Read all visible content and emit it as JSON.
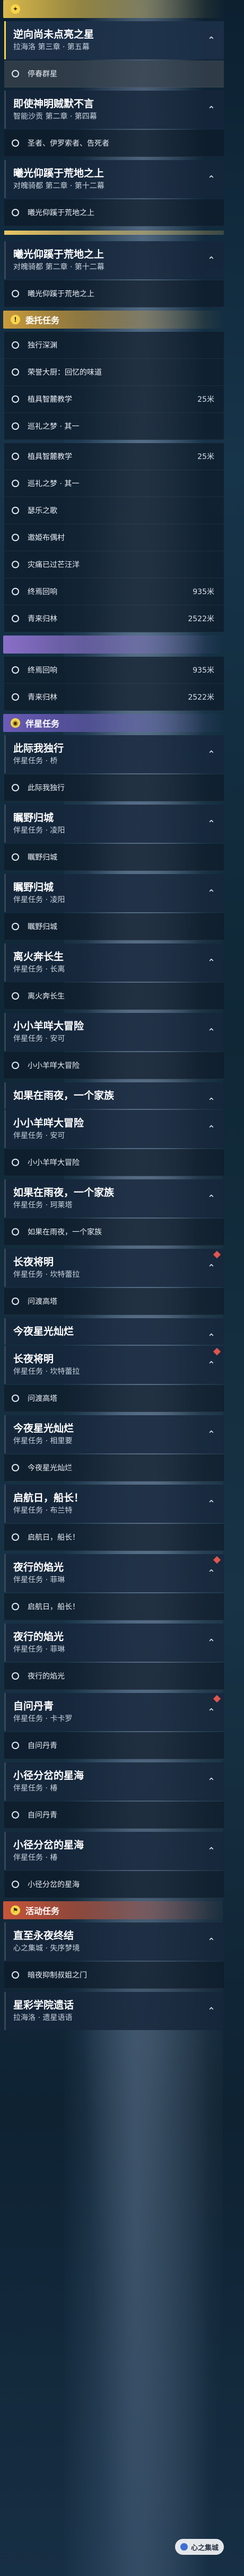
{
  "sections": [
    {
      "key": "main",
      "header": "",
      "color": "#d9b84a",
      "icon": "star-icon",
      "quests": [
        {
          "title": "逆向尚未点亮之星",
          "sub": "拉海洛 第三章 · 第五幕",
          "selected": true,
          "tasks": [
            {
              "label": "停春群星",
              "dist": "",
              "hl": true
            }
          ]
        },
        {
          "title": "即使神明贼默不言",
          "sub": "智能沙贡 第二章 · 第四幕",
          "selected": false,
          "tasks": [
            {
              "label": "圣者、伊罗索者、告死者",
              "dist": "",
              "hl": false
            }
          ]
        },
        {
          "title": "曦光仰蹊于荒地之上",
          "sub": "对魄骑都 第二章 · 第十二幕",
          "selected": false,
          "tasks": [
            {
              "label": "曦光仰蹊于荒地之上",
              "dist": "",
              "hl": false
            }
          ]
        }
      ],
      "after_gold": true
    },
    {
      "key": "main2",
      "header": "",
      "color": "",
      "icon": "",
      "quests": [
        {
          "title": "曦光仰蹊于荒地之上",
          "sub": "对魄骑都 第二章 · 第十二幕",
          "selected": false,
          "tasks": [
            {
              "label": "曦光仰蹊于荒地之上",
              "dist": "",
              "hl": false
            }
          ]
        }
      ],
      "after_gold": false
    },
    {
      "key": "daily",
      "header": "委托任务",
      "color": "#c99a3c",
      "icon": "exclaim-icon",
      "quests": [
        {
          "title": "",
          "sub": "",
          "selected": false,
          "tasks": [
            {
              "label": "独行深渊",
              "dist": "",
              "hl": false
            },
            {
              "label": "荣誉大厨：回忆的味道",
              "dist": "",
              "hl": false
            },
            {
              "label": "植具智麓教学",
              "dist": "25米",
              "hl": false
            },
            {
              "label": "巡礼之梦 · 其一",
              "dist": "",
              "hl": false
            }
          ]
        },
        {
          "title": "",
          "sub": "",
          "selected": false,
          "tasks": [
            {
              "label": "植具智麓教学",
              "dist": "25米",
              "hl": false
            },
            {
              "label": "巡礼之梦 · 其一",
              "dist": "",
              "hl": false
            },
            {
              "label": "瑟乐之歌",
              "dist": "",
              "hl": false
            },
            {
              "label": "邀姫布偶村",
              "dist": "",
              "hl": false
            },
            {
              "label": "灾痛已过芒汪洋",
              "dist": "",
              "hl": false
            },
            {
              "label": "终焉回响",
              "dist": "935米",
              "hl": false
            },
            {
              "label": "青来归林",
              "dist": "2522米",
              "hl": false
            }
          ]
        }
      ],
      "after_gold": false
    },
    {
      "key": "daily2",
      "header": "",
      "color": "#8a6fc8",
      "icon": "",
      "quests": [
        {
          "title": "",
          "sub": "",
          "selected": false,
          "tasks": [
            {
              "label": "终焉回响",
              "dist": "935米",
              "hl": false
            },
            {
              "label": "青来归林",
              "dist": "2522米",
              "hl": false
            }
          ]
        }
      ],
      "after_gold": false
    },
    {
      "key": "companion",
      "header": "伴星任务",
      "color": "#6b5bb8",
      "icon": "planet-icon",
      "quests": [
        {
          "title": "此际我独行",
          "sub": "伴星任务 · 桥",
          "selected": false,
          "tasks": [
            {
              "label": "此际我独行",
              "dist": "",
              "hl": false
            }
          ]
        },
        {
          "title": "瞩野归城",
          "sub": "伴星任务 · 凌阳",
          "selected": false,
          "tasks": [
            {
              "label": "瞩野归城",
              "dist": "",
              "hl": false
            }
          ]
        },
        {
          "title": "瞩野归城",
          "sub": "伴星任务 · 凌阳",
          "selected": false,
          "tasks": [
            {
              "label": "瞩野归城",
              "dist": "",
              "hl": false
            }
          ]
        },
        {
          "title": "离火奔长生",
          "sub": "伴星任务 · 长离",
          "selected": false,
          "tasks": [
            {
              "label": "离火奔长生",
              "dist": "",
              "hl": false
            }
          ]
        },
        {
          "title": "小小羊咩大冒险",
          "sub": "伴星任务 · 安可",
          "selected": false,
          "tasks": [
            {
              "label": "小小羊咩大冒险",
              "dist": "",
              "hl": false
            }
          ]
        },
        {
          "title": "如果在雨夜，一个家族",
          "sub": "",
          "selected": false,
          "tasks": []
        },
        {
          "title": "小小羊咩大冒险",
          "sub": "伴星任务 · 安可",
          "selected": false,
          "tasks": [
            {
              "label": "小小羊咩大冒险",
              "dist": "",
              "hl": false
            }
          ]
        },
        {
          "title": "如果在雨夜，一个家族",
          "sub": "伴星任务 · 珂莱塔",
          "selected": false,
          "tasks": [
            {
              "label": "如果在雨夜，一个家族",
              "dist": "",
              "hl": false
            }
          ]
        },
        {
          "title": "长夜将明",
          "sub": "伴星任务 · 坎特蕾拉",
          "selected": false,
          "diamond": true,
          "tasks": [
            {
              "label": "问渡高塔",
              "dist": "",
              "hl": false
            }
          ]
        },
        {
          "title": "今夜星光灿烂",
          "sub": "",
          "selected": false,
          "tasks": []
        },
        {
          "title": "长夜将明",
          "sub": "伴星任务 · 坎特蕾拉",
          "selected": false,
          "diamond": true,
          "tasks": [
            {
              "label": "问渡高塔",
              "dist": "",
              "hl": false
            }
          ]
        },
        {
          "title": "今夜星光灿烂",
          "sub": "伴星任务 · 相里要",
          "selected": false,
          "tasks": [
            {
              "label": "今夜星光灿烂",
              "dist": "",
              "hl": false
            }
          ]
        },
        {
          "title": "启航日，船长！",
          "sub": "伴星任务 · 布兰特",
          "selected": false,
          "tasks": [
            {
              "label": "启航日，船长！",
              "dist": "",
              "hl": false
            }
          ]
        },
        {
          "title": "夜行的焰光",
          "sub": "伴星任务 · 菲琳",
          "selected": false,
          "diamond": true,
          "tasks": [
            {
              "label": "启航日，船长！",
              "dist": "",
              "hl": false
            }
          ]
        },
        {
          "title": "夜行的焰光",
          "sub": "伴星任务 · 菲琳",
          "selected": false,
          "tasks": [
            {
              "label": "夜行的焰光",
              "dist": "",
              "hl": false
            }
          ]
        },
        {
          "title": "自问丹青",
          "sub": "伴星任务 · 卡卡罗",
          "selected": false,
          "diamond": true,
          "tasks": [
            {
              "label": "自问丹青",
              "dist": "",
              "hl": false
            }
          ]
        },
        {
          "title": "小径分岔的星海",
          "sub": "伴星任务 · 椿",
          "selected": false,
          "tasks": [
            {
              "label": "自问丹青",
              "dist": "",
              "hl": false
            }
          ]
        },
        {
          "title": "小径分岔的星海",
          "sub": "伴星任务 · 椿",
          "selected": false,
          "tasks": [
            {
              "label": "小径分岔的星海",
              "dist": "",
              "hl": false
            }
          ]
        }
      ],
      "after_gold": false
    },
    {
      "key": "event",
      "header": "活动任务",
      "color": "#c8553a",
      "icon": "flag-icon",
      "quests": [
        {
          "title": "直至永夜终结",
          "sub": "心之集城 · 失序梦境",
          "selected": false,
          "tasks": [
            {
              "label": "暗夜抑制叔姐之门",
              "dist": "",
              "hl": false
            }
          ]
        },
        {
          "title": "星彩学院遗话",
          "sub": "拉海洛 · 遗星语语",
          "selected": false,
          "tasks": []
        }
      ],
      "after_gold": false
    }
  ],
  "fab": {
    "label": "心之集城",
    "icon": "circle-icon"
  }
}
